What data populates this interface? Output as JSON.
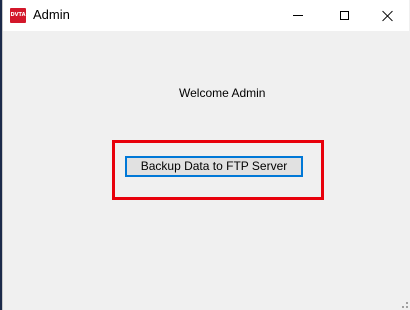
{
  "window": {
    "title": "Admin",
    "icon_text": "DVTA",
    "controls": {
      "minimize": "minimize-icon",
      "maximize": "maximize-icon",
      "close": "close-icon"
    }
  },
  "main": {
    "welcome_text": "Welcome Admin",
    "backup_button_label": "Backup Data to FTP Server"
  },
  "colors": {
    "highlight": "#e8000b",
    "button_focus_border": "#0078d7",
    "app_icon": "#d3172a"
  }
}
